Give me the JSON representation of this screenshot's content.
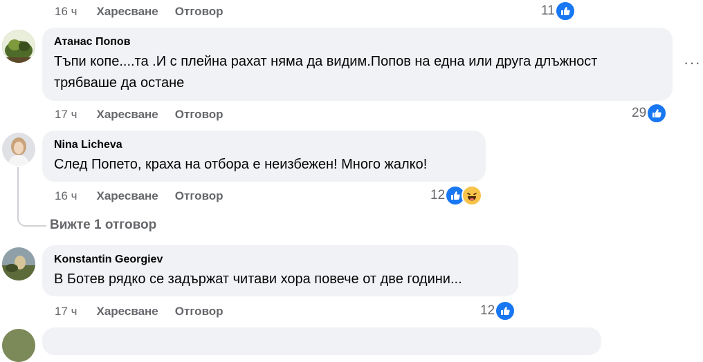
{
  "comments": [
    {
      "time": "16 ч",
      "like_label": "Харесване",
      "reply_label": "Отговор",
      "reaction_count": "11"
    },
    {
      "author": "Атанас Попов",
      "text": "Тъпи копе....та .И с плейна рахат няма да видим.Попов на една или друга длъжност трябваше да остане",
      "time": "17 ч",
      "like_label": "Харесване",
      "reply_label": "Отговор",
      "reaction_count": "29",
      "more_label": "···"
    },
    {
      "author": "Nina Licheva",
      "text": "След Попето, краха на отбора е неизбежен! Много жалко!",
      "time": "16 ч",
      "like_label": "Харесване",
      "reply_label": "Отговор",
      "reaction_count": "12",
      "view_replies": "Вижте 1 отговор"
    },
    {
      "author": "Konstantin Georgiev",
      "text": "В Ботев рядко се задържат читави хора повече от две години...",
      "time": "17 ч",
      "like_label": "Харесване",
      "reply_label": "Отговор",
      "reaction_count": "12"
    }
  ],
  "icons": {
    "like": "like-thumb-icon",
    "haha": "haha-emoji-icon",
    "more": "more-options-icon"
  },
  "colors": {
    "bubble": "#f0f2f5",
    "meta_text": "#65676b",
    "like_blue": "#1877f2",
    "haha_yellow": "#f7c34a"
  }
}
